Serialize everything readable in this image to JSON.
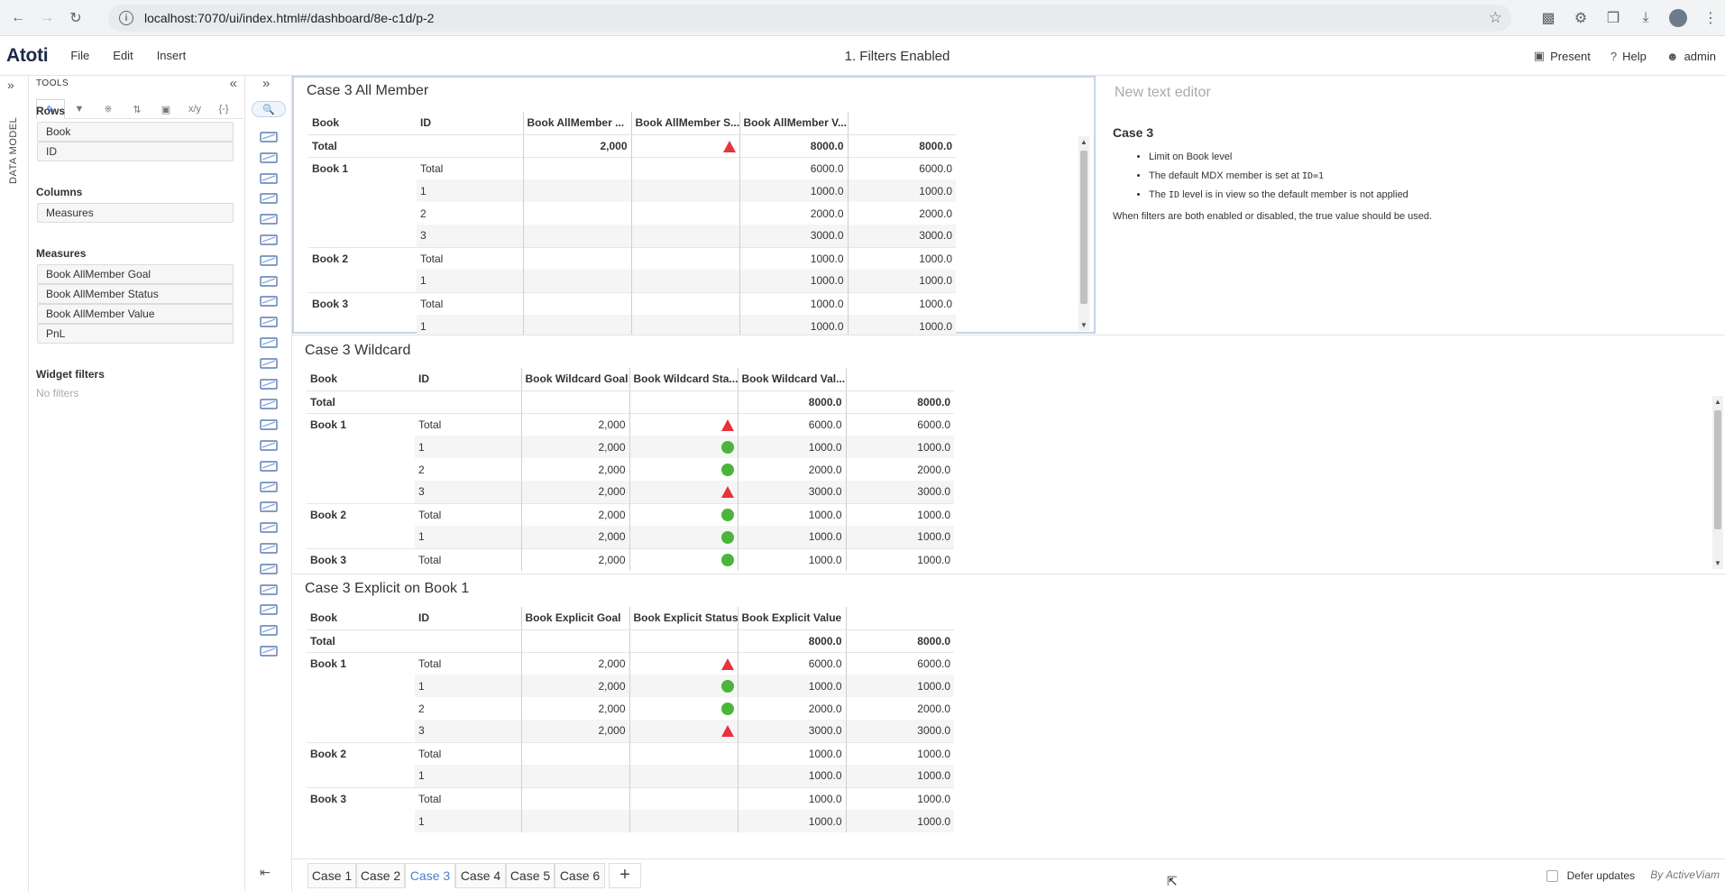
{
  "browser": {
    "url": "localhost:7070/ui/index.html#/dashboard/8e-c1d/p-2"
  },
  "header": {
    "logo": "Atoti",
    "menu": [
      "File",
      "Edit",
      "Insert"
    ],
    "title": "1. Filters Enabled",
    "present": "Present",
    "help": "Help",
    "user": "admin"
  },
  "rail": {
    "label": "DATA MODEL"
  },
  "tools": {
    "heading": "TOOLS",
    "rows_title": "Rows",
    "rows": [
      "Book",
      "ID"
    ],
    "columns_title": "Columns",
    "columns": [
      "Measures"
    ],
    "measures_title": "Measures",
    "measures": [
      "Book AllMember Goal",
      "Book AllMember Status",
      "Book AllMember Value",
      "PnL"
    ],
    "filters_title": "Widget filters",
    "no_filters": "No filters"
  },
  "widgets": {
    "w1": {
      "title": "Case 3 All Member",
      "headers": [
        "Book",
        "ID",
        "Book AllMember ...",
        "Book AllMember S...",
        "Book AllMember V...",
        ""
      ]
    },
    "w2": {
      "title": "Case 3 Wildcard",
      "headers": [
        "Book",
        "ID",
        "Book Wildcard Goal",
        "Book Wildcard Sta...",
        "Book Wildcard Val...",
        ""
      ]
    },
    "w3": {
      "title": "Case 3 Explicit on Book 1",
      "headers": [
        "Book",
        "ID",
        "Book Explicit Goal",
        "Book Explicit Status",
        "Book Explicit Value",
        ""
      ]
    }
  },
  "text_widget": {
    "placeholder": "New text editor",
    "heading": "Case 3",
    "bullet1": "Limit on Book level",
    "bullet2_pre": "The default MDX member is set at ",
    "bullet2_code": "ID=1",
    "bullet3_pre": "The ",
    "bullet3_code": "ID",
    "bullet3_post": " level is in view so the default member is not applied",
    "note": "When filters are both enabled or disabled, the true value should be used."
  },
  "pages": [
    "Case 1",
    "Case 2",
    "Case 3",
    "Case 4",
    "Case 5",
    "Case 6"
  ],
  "active_page": "Case 3",
  "footer": {
    "defer": "Defer updates",
    "brand": "By ActiveViam"
  },
  "colors": {
    "status_bad": "#e8323c",
    "status_good": "#4ab53a",
    "active_tab": "#4a7fd4"
  }
}
